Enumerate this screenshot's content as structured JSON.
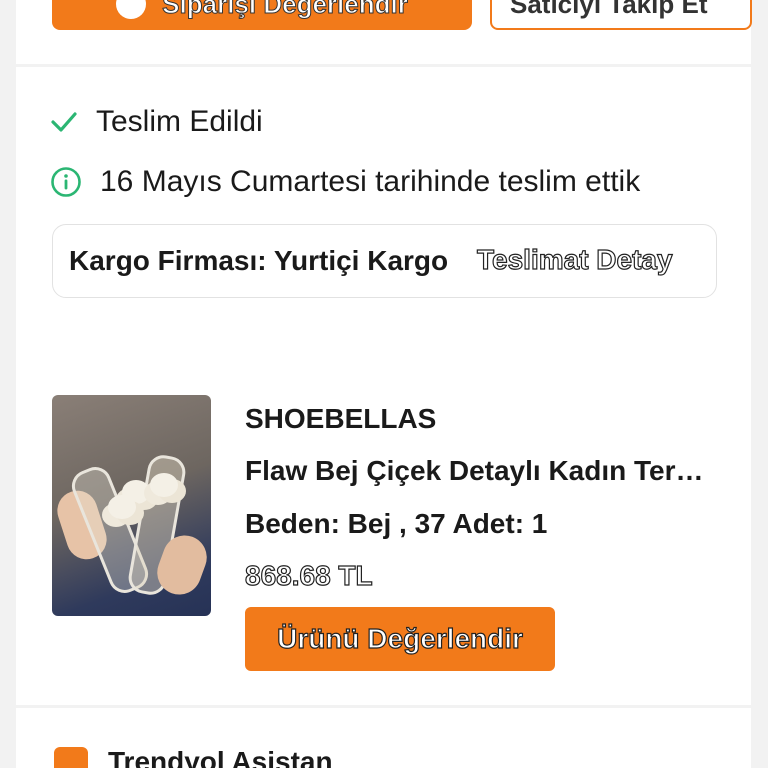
{
  "top_actions": {
    "rate_order_label": "Siparişi Değerlendir",
    "follow_seller_label": "Satıcıyı Takip Et"
  },
  "delivery": {
    "status": "Teslim Edildi",
    "date_text": "16 Mayıs Cumartesi tarihinde teslim ettik",
    "cargo_label": "Kargo Firması: Yurtiçi Kargo",
    "detail_link": "Teslimat Detay"
  },
  "product": {
    "brand": "SHOEBELLAS",
    "name": "Flaw Bej Çiçek Detaylı Kadın Terlik",
    "variant": "Beden: Bej , 37  Adet: 1",
    "price": "868.68 TL",
    "rate_button": "Ürünü Değerlendir"
  },
  "assistant": {
    "title": "Trendyol Asistan"
  },
  "colors": {
    "accent": "#f27a1a",
    "success": "#2bb673"
  }
}
